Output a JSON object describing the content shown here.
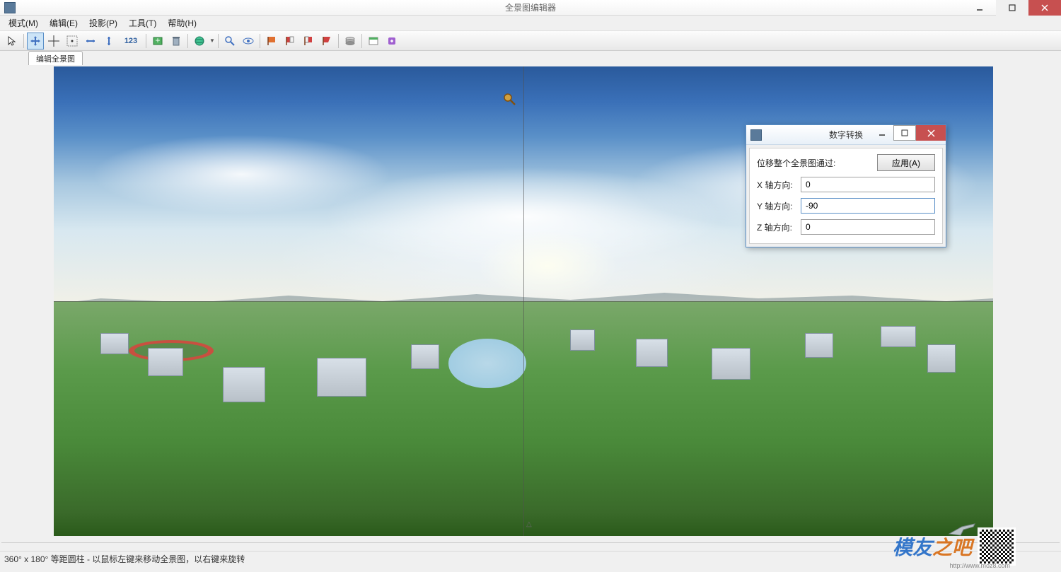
{
  "window": {
    "title": "全景图编辑器"
  },
  "menu": {
    "mode": "模式(M)",
    "edit": "编辑(E)",
    "projection": "投影(P)",
    "tools": "工具(T)",
    "help": "帮助(H)"
  },
  "toolbar": {
    "number_hint": "123"
  },
  "tab": {
    "label": "编辑全景图"
  },
  "dialog": {
    "title": "数字转换",
    "description": "位移整个全景图通过:",
    "apply": "应用(A)",
    "x_label": "X 轴方向:",
    "y_label": "Y 轴方向:",
    "z_label": "Z 轴方向:",
    "x_value": "0",
    "y_value": "-90",
    "z_value": "0"
  },
  "status": {
    "text": "360° x 180° 等距圆柱 - 以鼠标左键来移动全景图，以右键来旋转"
  },
  "watermark": {
    "text1": "模友",
    "text2": "之吧",
    "url": "http://www.moz8.com"
  }
}
